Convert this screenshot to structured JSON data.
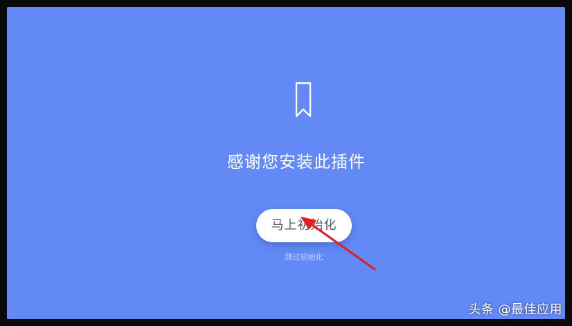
{
  "colors": {
    "background": "#6289f5",
    "button_bg": "#ffffff",
    "button_text": "#555c66",
    "arrow": "#e02020"
  },
  "icon": "bookmark-icon",
  "welcome": {
    "title": "感谢您安装此插件"
  },
  "actions": {
    "init_button_label": "马上初始化",
    "skip_label": "跳过初始化"
  },
  "watermark": {
    "text": "头条 @最佳应用"
  }
}
